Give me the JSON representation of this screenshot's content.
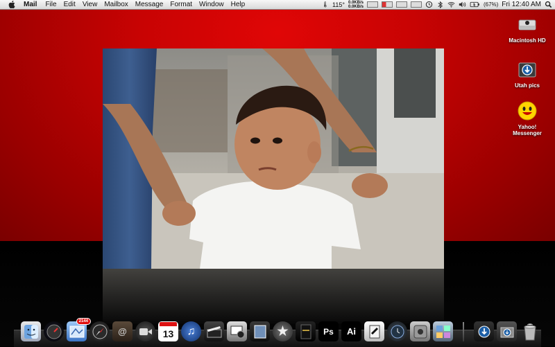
{
  "menubar": {
    "app_name": "Mail",
    "items": [
      "File",
      "Edit",
      "View",
      "Mailbox",
      "Message",
      "Format",
      "Window",
      "Help"
    ],
    "status": {
      "temperature": "115°",
      "net_up": "0.0KB/s",
      "net_down": "0.0KB/s",
      "battery_percent": "(67%)",
      "clock": "Fri 12:40 AM"
    }
  },
  "desktop_icons": [
    {
      "label": "Macintosh HD",
      "icon": "hard-drive-icon"
    },
    {
      "label": "Utah pics",
      "icon": "download-folder-icon"
    },
    {
      "label": "Yahoo! Messenger",
      "icon": "yahoo-messenger-icon"
    }
  ],
  "dock": {
    "mail_badge": "2144",
    "calendar_day": "13",
    "photoshop_label": "Ps",
    "illustrator_label": "Ai"
  },
  "colors": {
    "desktop_red": "#cc0000",
    "menubar": "#e6e6e6"
  }
}
